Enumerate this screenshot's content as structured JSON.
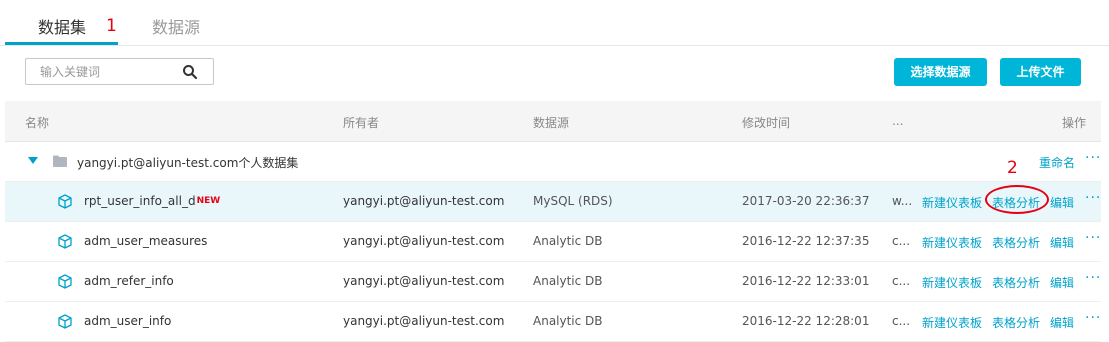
{
  "tabs": [
    {
      "label": "数据集",
      "active": true
    },
    {
      "label": "数据源",
      "active": false
    }
  ],
  "annotations": {
    "one": "1",
    "two": "2"
  },
  "search": {
    "placeholder": "输入关键词",
    "value": ""
  },
  "toolbar": {
    "select_source_label": "选择数据源",
    "upload_label": "上传文件"
  },
  "table": {
    "headers": {
      "name": "名称",
      "owner": "所有者",
      "source": "数据源",
      "modified": "修改时间",
      "extra": "...",
      "actions": "操作"
    },
    "folder": {
      "name": "yangyi.pt@aliyun-test.com个人数据集",
      "rename_label": "重命名",
      "more_label": "···"
    },
    "rows": [
      {
        "name": "rpt_user_info_all_d",
        "badge": "NEW",
        "owner": "yangyi.pt@aliyun-test.com",
        "source": "MySQL (RDS)",
        "modified": "2017-03-20 22:36:37",
        "extra": "w...",
        "new_dashboard": "新建仪表板",
        "table_analysis": "表格分析",
        "edit": "编辑",
        "more": "···"
      },
      {
        "name": "adm_user_measures",
        "owner": "yangyi.pt@aliyun-test.com",
        "source": "Analytic DB",
        "modified": "2016-12-22 12:37:35",
        "extra": "c...",
        "new_dashboard": "新建仪表板",
        "table_analysis": "表格分析",
        "edit": "编辑",
        "more": "···"
      },
      {
        "name": "adm_refer_info",
        "owner": "yangyi.pt@aliyun-test.com",
        "source": "Analytic DB",
        "modified": "2016-12-22 12:33:01",
        "extra": "c...",
        "new_dashboard": "新建仪表板",
        "table_analysis": "表格分析",
        "edit": "编辑",
        "more": "···"
      },
      {
        "name": "adm_user_info",
        "owner": "yangyi.pt@aliyun-test.com",
        "source": "Analytic DB",
        "modified": "2016-12-22 12:28:01",
        "extra": "c...",
        "new_dashboard": "新建仪表板",
        "table_analysis": "表格分析",
        "edit": "编辑",
        "more": "···"
      }
    ]
  },
  "colors": {
    "accent": "#00b6d8",
    "link": "#00a2ca",
    "annotation": "#e60012",
    "row_highlight": "#e9f7fb"
  }
}
